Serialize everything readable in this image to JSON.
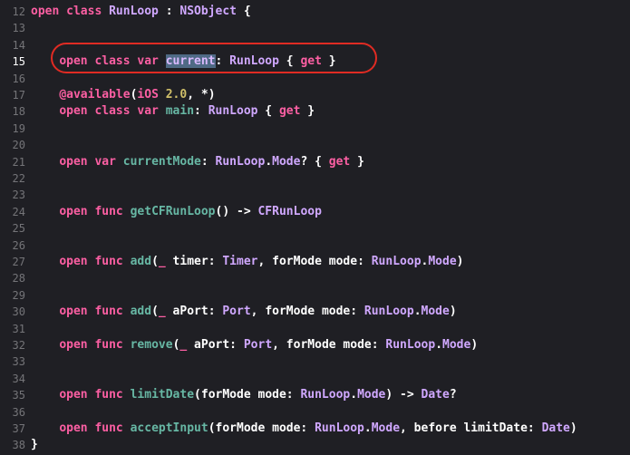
{
  "editor": {
    "lines": [
      {
        "n": "12",
        "tokens": [
          [
            "kw",
            "open class "
          ],
          [
            "ty",
            "RunLoop"
          ],
          [
            "pl",
            " : "
          ],
          [
            "ty",
            "NSObject"
          ],
          [
            "pl",
            " {"
          ]
        ]
      },
      {
        "n": "13",
        "tokens": []
      },
      {
        "n": "14",
        "tokens": []
      },
      {
        "n": "15",
        "current": true,
        "tokens": [
          [
            "pl",
            "    "
          ],
          [
            "kw",
            "open class var "
          ],
          [
            "sel",
            "current"
          ],
          [
            "pl",
            ": "
          ],
          [
            "ty",
            "RunLoop"
          ],
          [
            "pl",
            " { "
          ],
          [
            "kw",
            "get"
          ],
          [
            "pl",
            " }"
          ]
        ]
      },
      {
        "n": "16",
        "tokens": []
      },
      {
        "n": "17",
        "tokens": [
          [
            "pl",
            "    "
          ],
          [
            "kw",
            "@available"
          ],
          [
            "pl",
            "("
          ],
          [
            "kw",
            "iOS"
          ],
          [
            "pl",
            " "
          ],
          [
            "num",
            "2.0"
          ],
          [
            "pl",
            ", *)"
          ]
        ]
      },
      {
        "n": "18",
        "tokens": [
          [
            "pl",
            "    "
          ],
          [
            "kw",
            "open class var "
          ],
          [
            "fn",
            "main"
          ],
          [
            "pl",
            ": "
          ],
          [
            "ty",
            "RunLoop"
          ],
          [
            "pl",
            " { "
          ],
          [
            "kw",
            "get"
          ],
          [
            "pl",
            " }"
          ]
        ]
      },
      {
        "n": "19",
        "tokens": []
      },
      {
        "n": "20",
        "tokens": []
      },
      {
        "n": "21",
        "tokens": [
          [
            "pl",
            "    "
          ],
          [
            "kw",
            "open var "
          ],
          [
            "fn",
            "currentMode"
          ],
          [
            "pl",
            ": "
          ],
          [
            "ty",
            "RunLoop"
          ],
          [
            "pl",
            "."
          ],
          [
            "ty",
            "Mode"
          ],
          [
            "pl",
            "? { "
          ],
          [
            "kw",
            "get"
          ],
          [
            "pl",
            " }"
          ]
        ]
      },
      {
        "n": "22",
        "tokens": []
      },
      {
        "n": "23",
        "tokens": []
      },
      {
        "n": "24",
        "tokens": [
          [
            "pl",
            "    "
          ],
          [
            "kw",
            "open func "
          ],
          [
            "fn",
            "getCFRunLoop"
          ],
          [
            "pl",
            "() -> "
          ],
          [
            "ty",
            "CFRunLoop"
          ]
        ]
      },
      {
        "n": "25",
        "tokens": []
      },
      {
        "n": "26",
        "tokens": []
      },
      {
        "n": "27",
        "tokens": [
          [
            "pl",
            "    "
          ],
          [
            "kw",
            "open func "
          ],
          [
            "fn",
            "add"
          ],
          [
            "pl",
            "("
          ],
          [
            "kw",
            "_"
          ],
          [
            "pl",
            " timer: "
          ],
          [
            "ty",
            "Timer"
          ],
          [
            "pl",
            ", forMode mode: "
          ],
          [
            "ty",
            "RunLoop"
          ],
          [
            "pl",
            "."
          ],
          [
            "ty",
            "Mode"
          ],
          [
            "pl",
            ")"
          ]
        ]
      },
      {
        "n": "28",
        "tokens": []
      },
      {
        "n": "29",
        "tokens": []
      },
      {
        "n": "30",
        "tokens": [
          [
            "pl",
            "    "
          ],
          [
            "kw",
            "open func "
          ],
          [
            "fn",
            "add"
          ],
          [
            "pl",
            "("
          ],
          [
            "kw",
            "_"
          ],
          [
            "pl",
            " aPort: "
          ],
          [
            "ty",
            "Port"
          ],
          [
            "pl",
            ", forMode mode: "
          ],
          [
            "ty",
            "RunLoop"
          ],
          [
            "pl",
            "."
          ],
          [
            "ty",
            "Mode"
          ],
          [
            "pl",
            ")"
          ]
        ]
      },
      {
        "n": "31",
        "tokens": []
      },
      {
        "n": "32",
        "tokens": [
          [
            "pl",
            "    "
          ],
          [
            "kw",
            "open func "
          ],
          [
            "fn",
            "remove"
          ],
          [
            "pl",
            "("
          ],
          [
            "kw",
            "_"
          ],
          [
            "pl",
            " aPort: "
          ],
          [
            "ty",
            "Port"
          ],
          [
            "pl",
            ", forMode mode: "
          ],
          [
            "ty",
            "RunLoop"
          ],
          [
            "pl",
            "."
          ],
          [
            "ty",
            "Mode"
          ],
          [
            "pl",
            ")"
          ]
        ]
      },
      {
        "n": "33",
        "tokens": []
      },
      {
        "n": "34",
        "tokens": []
      },
      {
        "n": "35",
        "tokens": [
          [
            "pl",
            "    "
          ],
          [
            "kw",
            "open func "
          ],
          [
            "fn",
            "limitDate"
          ],
          [
            "pl",
            "(forMode mode: "
          ],
          [
            "ty",
            "RunLoop"
          ],
          [
            "pl",
            "."
          ],
          [
            "ty",
            "Mode"
          ],
          [
            "pl",
            ") -> "
          ],
          [
            "ty",
            "Date"
          ],
          [
            "pl",
            "?"
          ]
        ]
      },
      {
        "n": "36",
        "tokens": []
      },
      {
        "n": "37",
        "tokens": [
          [
            "pl",
            "    "
          ],
          [
            "kw",
            "open func "
          ],
          [
            "fn",
            "acceptInput"
          ],
          [
            "pl",
            "(forMode mode: "
          ],
          [
            "ty",
            "RunLoop"
          ],
          [
            "pl",
            "."
          ],
          [
            "ty",
            "Mode"
          ],
          [
            "pl",
            ", before limitDate: "
          ],
          [
            "ty",
            "Date"
          ],
          [
            "pl",
            ")"
          ]
        ]
      },
      {
        "n": "38",
        "tokens": [
          [
            "pl",
            "}"
          ]
        ]
      }
    ]
  }
}
